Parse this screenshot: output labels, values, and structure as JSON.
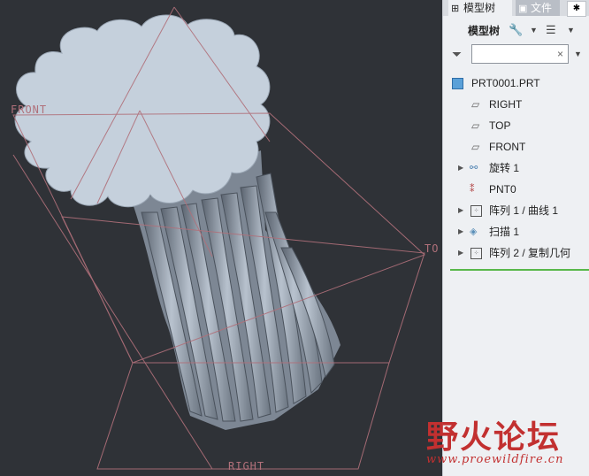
{
  "viewport": {
    "plane_labels": {
      "front": "FRONT",
      "top": "TO",
      "right": "RIGHT"
    },
    "colors": {
      "background": "#2f3237",
      "model": "#a9b3c0",
      "datum": "#b0707a"
    }
  },
  "panel": {
    "tabs": [
      {
        "label": "模型树",
        "icon": "model-tree-icon"
      },
      {
        "label": "文件",
        "icon": "folder-icon"
      }
    ],
    "toolbar": {
      "label": "模型树"
    },
    "filter": {
      "value": "",
      "clear_symbol": "×"
    },
    "tree": [
      {
        "label": "PRT0001.PRT",
        "icon": "part-icon",
        "expandable": false
      },
      {
        "label": "RIGHT",
        "icon": "datum-plane-icon",
        "expandable": false
      },
      {
        "label": "TOP",
        "icon": "datum-plane-icon",
        "expandable": false
      },
      {
        "label": "FRONT",
        "icon": "datum-plane-icon",
        "expandable": false
      },
      {
        "label": "旋转 1",
        "icon": "revolve-icon",
        "expandable": true
      },
      {
        "label": "PNT0",
        "icon": "datum-point-icon",
        "expandable": false
      },
      {
        "label": "阵列 1 / 曲线 1",
        "icon": "pattern-icon",
        "expandable": true
      },
      {
        "label": "扫描 1",
        "icon": "sweep-icon",
        "expandable": true
      },
      {
        "label": "阵列 2 / 复制几何",
        "icon": "pattern-icon",
        "expandable": true
      }
    ],
    "accent": "#58b84a"
  },
  "watermark": {
    "title": "野火论坛",
    "url": "www.proewildfire.cn",
    "color": "#c23030"
  }
}
